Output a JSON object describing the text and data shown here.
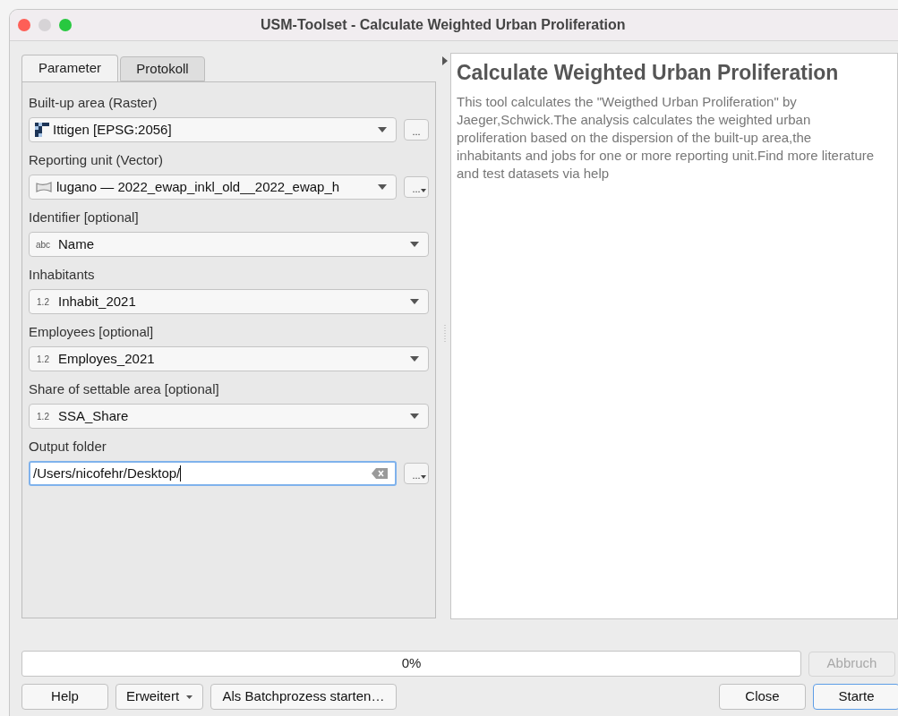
{
  "window": {
    "title": "USM-Toolset - Calculate Weighted Urban Proliferation"
  },
  "tabs": [
    {
      "label": "Parameter",
      "selected": true
    },
    {
      "label": "Protokoll",
      "selected": false
    }
  ],
  "parameters": [
    {
      "label": "Built-up area (Raster)",
      "kind": "raster",
      "value": "Ittigen [EPSG:2056]",
      "browse": {
        "label": "...",
        "menu": false
      }
    },
    {
      "label": "Reporting unit (Vector)",
      "kind": "vector",
      "value": "lugano — 2022_ewap_inkl_old__2022_ewap_h",
      "browse": {
        "label": "...",
        "menu": true
      }
    },
    {
      "label": "Identifier [optional]",
      "kind": "field",
      "type_label": "abc",
      "value": "Name"
    },
    {
      "label": "Inhabitants",
      "kind": "field",
      "type_label": "1.2",
      "value": "Inhabit_2021"
    },
    {
      "label": "Employees [optional]",
      "kind": "field",
      "type_label": "1.2",
      "value": "Employes_2021"
    },
    {
      "label": "Share of settable area [optional]",
      "kind": "field",
      "type_label": "1.2",
      "value": "SSA_Share"
    },
    {
      "label": "Output folder",
      "kind": "path",
      "value": "/Users/nicofehr/Desktop/",
      "focused": true,
      "browse": {
        "label": "...",
        "menu": true
      }
    }
  ],
  "description": {
    "title": "Calculate Weighted Urban Proliferation",
    "text": "This tool calculates the \"Weigthed Urban Proliferation\" by Jaeger,Schwick.The analysis calculates the weighted urban proliferation based on the dispersion of the built-up area,the inhabitants and jobs for one or more reporting unit.Find more literature and test datasets via help"
  },
  "progress": {
    "level": 0,
    "text": "0%"
  },
  "cancel_button": {
    "label": "Abbruch",
    "disabled": true
  },
  "buttons": [
    {
      "label": "Help",
      "kind": "plain"
    },
    {
      "label": "Erweitert",
      "kind": "menu"
    },
    {
      "label": "Als Batchprozess starten…",
      "kind": "plain"
    },
    {
      "label": "Close",
      "kind": "plain"
    },
    {
      "label": "Starte",
      "kind": "default"
    }
  ]
}
